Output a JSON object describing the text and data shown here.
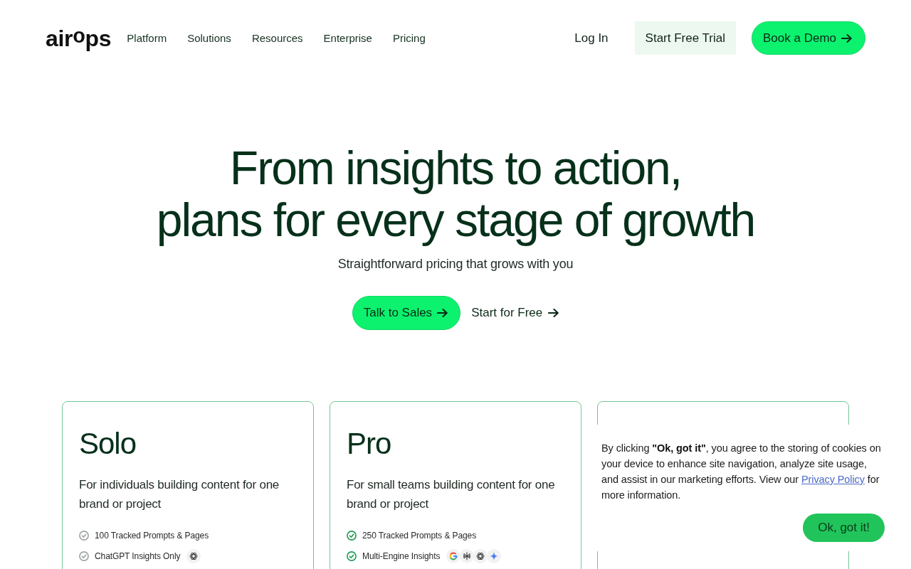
{
  "header": {
    "logo": "air$^{o}$ps",
    "nav": [
      {
        "label": "Platform"
      },
      {
        "label": "Solutions"
      },
      {
        "label": "Resources"
      },
      {
        "label": "Enterprise"
      },
      {
        "label": "Pricing"
      }
    ],
    "login": "Log In",
    "trial_button": "Start Free Trial",
    "demo_button": "Book a Demo"
  },
  "hero": {
    "title_lines": [
      "From insights to action,",
      "plans for every stage of growth"
    ],
    "subtitle": "Straightforward pricing that grows with you",
    "primary_button": "Talk to Sales",
    "secondary_link": "Start for Free"
  },
  "plans": [
    {
      "name": "Solo",
      "description": "For individuals building content for one brand or project",
      "color": "#9ea5a1",
      "features": [
        {
          "text": "100 Tracked Prompts & Pages"
        },
        {
          "text": "ChatGPT Insights Only",
          "engines": [
            {
              "kind": "knot"
            }
          ]
        }
      ]
    },
    {
      "name": "Pro",
      "description": "For small teams building content for one brand or project",
      "color": "#1f9d52",
      "features": [
        {
          "text": "250 Tracked Prompts & Pages"
        },
        {
          "text": "Multi-Engine Insights",
          "engines": [
            {
              "kind": "g-mark"
            },
            {
              "kind": "tree"
            },
            {
              "kind": "knot"
            },
            {
              "kind": "sparkle"
            }
          ]
        }
      ]
    }
  ],
  "cookie_banner": {
    "text": "By clicking **\"Ok, got it\"**, you agree to the storing of cookies on your device to enhance site navigation, analyze site usage, and assist in our marketing efforts. View our",
    "link": "Privacy Policy",
    "text_after": "for more information.",
    "button": "Ok, got it!"
  }
}
